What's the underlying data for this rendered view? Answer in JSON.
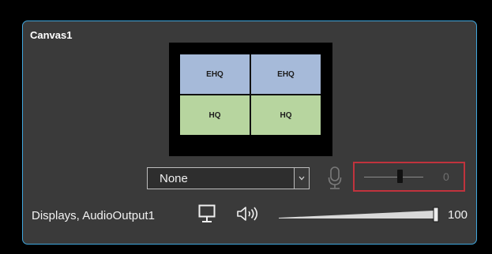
{
  "canvas": {
    "title": "Canvas1",
    "layout": [
      {
        "label": "EHQ",
        "color": "#a6bad9"
      },
      {
        "label": "EHQ",
        "color": "#a6bad9"
      },
      {
        "label": "HQ",
        "color": "#b7d59f"
      },
      {
        "label": "HQ",
        "color": "#b7d59f"
      }
    ]
  },
  "source_select": {
    "value": "None",
    "icon": "chevron-down-icon"
  },
  "microphone": {
    "icon": "microphone-icon",
    "volume": 0,
    "volume_label": "0",
    "slider_fraction": 0.6
  },
  "output": {
    "label": "Displays, AudioOutput1",
    "display_icon": "monitor-icon",
    "audio_icon": "speaker-icon",
    "volume": 100,
    "volume_label": "100"
  },
  "colors": {
    "panel_border": "#3fa6dd",
    "highlight_border": "#c0333d",
    "panel_background": "#3a3a3a"
  }
}
